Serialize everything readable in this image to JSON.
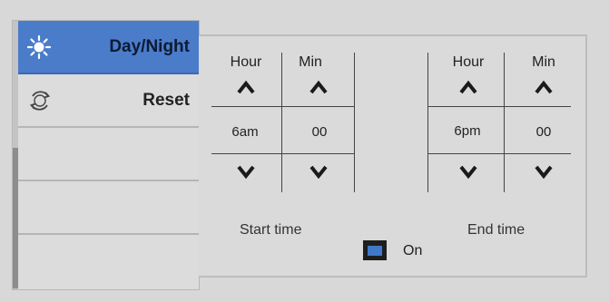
{
  "sidebar": {
    "items": [
      {
        "label": "Day/Night",
        "icon": "sun-moon-icon",
        "active": true
      },
      {
        "label": "Reset",
        "icon": "reset-icon",
        "active": false
      },
      {
        "label": "",
        "active": false
      },
      {
        "label": "",
        "active": false
      },
      {
        "label": "",
        "active": false
      }
    ]
  },
  "start": {
    "hour_header": "Hour",
    "min_header": "Min",
    "hour_value": "6am",
    "min_value": "00",
    "caption": "Start time"
  },
  "end": {
    "hour_header": "Hour",
    "min_header": "Min",
    "hour_value": "6pm",
    "min_value": "00",
    "caption": "End time"
  },
  "toggle": {
    "label": "On",
    "checked": true
  },
  "colors": {
    "accent": "#4a7cc9",
    "toggle_fill": "#3f79c8",
    "background": "#d8d8d8"
  }
}
